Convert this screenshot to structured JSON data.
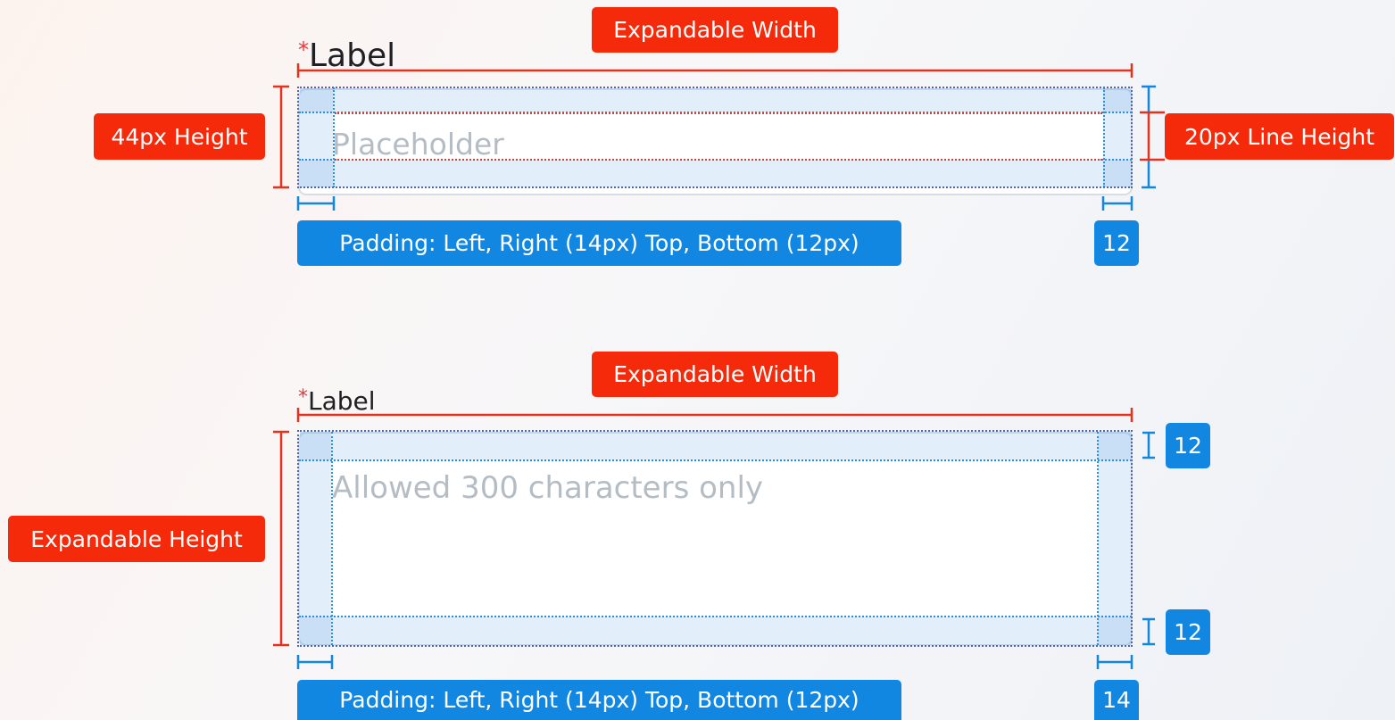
{
  "diagram1": {
    "width_tag": "Expandable Width",
    "label_star": "*",
    "label_text": "Label",
    "placeholder": "Placeholder",
    "height_tag": "44px Height",
    "line_height_tag": "20px Line Height",
    "padding_tag": "Padding: Left, Right (14px) Top, Bottom (12px)",
    "right_padding_value": "12"
  },
  "diagram2": {
    "width_tag": "Expandable Width",
    "label_star": "*",
    "label_text": "Label",
    "placeholder": "Allowed 300 characters only",
    "height_tag": "Expandable Height",
    "top_padding_value": "12",
    "bottom_padding_value": "12",
    "padding_tag": "Padding: Left, Right (14px) Top, Bottom (12px)",
    "right_padding_value": "14"
  },
  "colors": {
    "annotation_red": "#f42a0a",
    "annotation_blue": "#1287e2",
    "required_star": "#e5383b",
    "placeholder_gray": "#b4bcc4"
  }
}
